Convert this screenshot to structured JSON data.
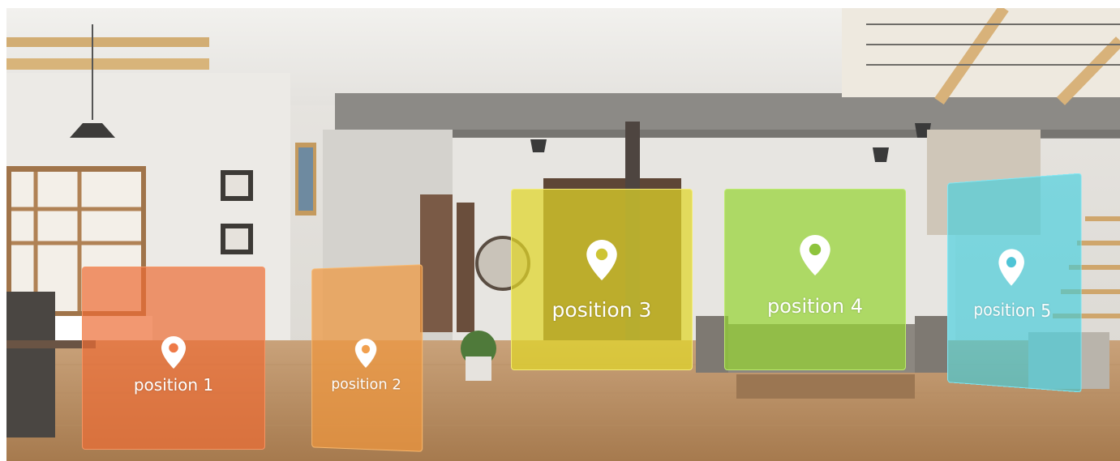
{
  "scene": {
    "description_icon": "pin-icon",
    "positions": [
      {
        "label": "position 1",
        "color": "#EC6C34"
      },
      {
        "label": "position 2",
        "color": "#F0963C"
      },
      {
        "label": "position 3",
        "color": "#E0D628"
      },
      {
        "label": "position 4",
        "color": "#94D430"
      },
      {
        "label": "position 5",
        "color": "#3CCEDE"
      }
    ]
  }
}
